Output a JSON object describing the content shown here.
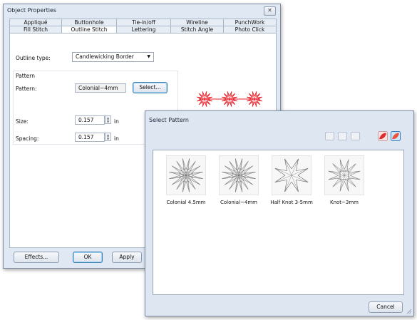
{
  "main_dialog": {
    "title": "Object Properties",
    "close_label": "✕",
    "tabs_row1": [
      "Appliqué",
      "Buttonhole",
      "Tie-in/off",
      "Wireline",
      "PunchWork"
    ],
    "tabs_row2": [
      "Fill Stitch",
      "Outline Stitch",
      "Lettering",
      "Stitch Angle",
      "Photo Click"
    ],
    "active_tab": "Outline Stitch",
    "outline_type_label": "Outline type:",
    "outline_type_value": "Candlewicking Border",
    "pattern_group_label": "Pattern",
    "pattern_label": "Pattern:",
    "pattern_value": "Colonial~4mm",
    "select_button": "Select...",
    "size_label": "Size:",
    "size_value": "0.157",
    "size_unit": "in",
    "spacing_label": "Spacing:",
    "spacing_value": "0.157",
    "spacing_unit": "in",
    "effects_button": "Effects...",
    "ok_button": "OK",
    "apply_button": "Apply",
    "preview_color": "#e8202a"
  },
  "select_dialog": {
    "title": "Select Pattern",
    "cancel_button": "Cancel",
    "toolbar_icons": [
      "large-icons-view-icon",
      "list-view-icon",
      "small-icons-view-icon",
      "red-pattern-icon",
      "blue-pattern-icon"
    ],
    "patterns": [
      {
        "name": "Colonial 4.5mm",
        "shape": "colonial"
      },
      {
        "name": "Colonial~4mm",
        "shape": "colonial"
      },
      {
        "name": "Half Knot 3-5mm",
        "shape": "star"
      },
      {
        "name": "Knot~3mm",
        "shape": "knot"
      }
    ]
  }
}
